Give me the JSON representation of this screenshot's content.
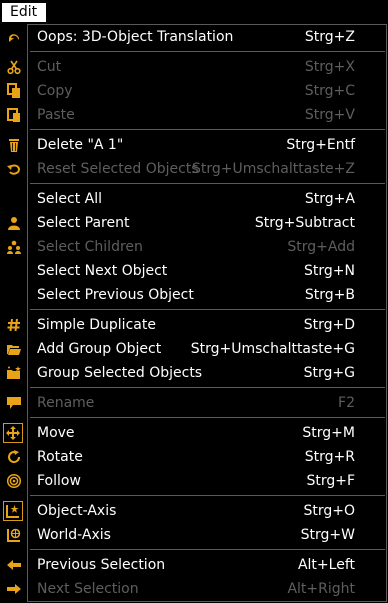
{
  "menubar": {
    "title": "Edit"
  },
  "colors": {
    "icon": "#e8a317",
    "text": "#ffffff",
    "disabled": "#5e5e5e",
    "background": "#000000",
    "separator": "#5a5a5a"
  },
  "items": [
    {
      "label": "Oops: 3D-Object Translation",
      "shortcut": "Strg+Z",
      "enabled": true,
      "icon": "undo-icon"
    },
    {
      "label": "Cut",
      "shortcut": "Strg+X",
      "enabled": false,
      "icon": "scissors-icon"
    },
    {
      "label": "Copy",
      "shortcut": "Strg+C",
      "enabled": false,
      "icon": "copy-icon"
    },
    {
      "label": "Paste",
      "shortcut": "Strg+V",
      "enabled": false,
      "icon": "paste-icon"
    },
    {
      "label": "Delete \"A 1\"",
      "shortcut": "Strg+Entf",
      "enabled": true,
      "icon": "trash-icon"
    },
    {
      "label": "Reset Selected Objects",
      "shortcut": "Strg+Umschalttaste+Z",
      "enabled": false,
      "icon": "reset-icon"
    },
    {
      "label": "Select All",
      "shortcut": "Strg+A",
      "enabled": true,
      "icon": ""
    },
    {
      "label": "Select Parent",
      "shortcut": "Strg+Subtract",
      "enabled": true,
      "icon": "person-icon"
    },
    {
      "label": "Select Children",
      "shortcut": "Strg+Add",
      "enabled": false,
      "icon": "people-icon"
    },
    {
      "label": "Select Next Object",
      "shortcut": "Strg+N",
      "enabled": true,
      "icon": ""
    },
    {
      "label": "Select Previous Object",
      "shortcut": "Strg+B",
      "enabled": true,
      "icon": ""
    },
    {
      "label": "Simple Duplicate",
      "shortcut": "Strg+D",
      "enabled": true,
      "icon": "hash-icon"
    },
    {
      "label": "Add Group Object",
      "shortcut": "Strg+Umschalttaste+G",
      "enabled": true,
      "icon": "folder-open-icon"
    },
    {
      "label": "Group Selected Objects",
      "shortcut": "Strg+G",
      "enabled": true,
      "icon": "folder-star-icon"
    },
    {
      "label": "Rename",
      "shortcut": "F2",
      "enabled": false,
      "icon": "speech-bubble-icon"
    },
    {
      "label": "Move",
      "shortcut": "Strg+M",
      "enabled": true,
      "icon": "move-arrows-icon"
    },
    {
      "label": "Rotate",
      "shortcut": "Strg+R",
      "enabled": true,
      "icon": "rotate-icon"
    },
    {
      "label": "Follow",
      "shortcut": "Strg+F",
      "enabled": true,
      "icon": "target-icon"
    },
    {
      "label": "Object-Axis",
      "shortcut": "Strg+O",
      "enabled": true,
      "icon": "object-axis-icon"
    },
    {
      "label": "World-Axis",
      "shortcut": "Strg+W",
      "enabled": true,
      "icon": "world-axis-icon"
    },
    {
      "label": "Previous Selection",
      "shortcut": "Alt+Left",
      "enabled": true,
      "icon": "arrow-left-icon"
    },
    {
      "label": "Next Selection",
      "shortcut": "Alt+Right",
      "enabled": false,
      "icon": "arrow-right-icon"
    }
  ]
}
